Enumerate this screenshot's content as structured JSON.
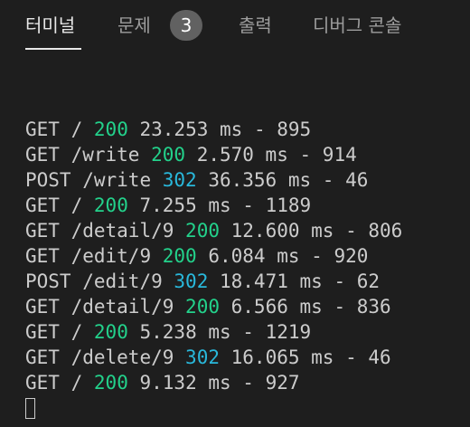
{
  "tabs": [
    {
      "label": "터미널",
      "active": true
    },
    {
      "label": "문제",
      "badge": "3"
    },
    {
      "label": "출력"
    },
    {
      "label": "디버그 콘솔"
    }
  ],
  "terminal": {
    "lines": [
      {
        "method": "GET",
        "path": "/",
        "status": "200",
        "time": "23.253 ms",
        "size": "895"
      },
      {
        "method": "GET",
        "path": "/write",
        "status": "200",
        "time": "2.570 ms",
        "size": "914"
      },
      {
        "method": "POST",
        "path": "/write",
        "status": "302",
        "time": "36.356 ms",
        "size": "46"
      },
      {
        "method": "GET",
        "path": "/",
        "status": "200",
        "time": "7.255 ms",
        "size": "1189"
      },
      {
        "method": "GET",
        "path": "/detail/9",
        "status": "200",
        "time": "12.600 ms",
        "size": "806"
      },
      {
        "method": "GET",
        "path": "/edit/9",
        "status": "200",
        "time": "6.084 ms",
        "size": "920"
      },
      {
        "method": "POST",
        "path": "/edit/9",
        "status": "302",
        "time": "18.471 ms",
        "size": "62"
      },
      {
        "method": "GET",
        "path": "/detail/9",
        "status": "200",
        "time": "6.566 ms",
        "size": "836"
      },
      {
        "method": "GET",
        "path": "/",
        "status": "200",
        "time": "5.238 ms",
        "size": "1219"
      },
      {
        "method": "GET",
        "path": "/delete/9",
        "status": "302",
        "time": "16.065 ms",
        "size": "46"
      },
      {
        "method": "GET",
        "path": "/",
        "status": "200",
        "time": "9.132 ms",
        "size": "927"
      }
    ]
  },
  "colors": {
    "background": "#1e1e1e",
    "status_200": "#23d18b",
    "status_302": "#29b8db",
    "text": "#cccccc"
  }
}
